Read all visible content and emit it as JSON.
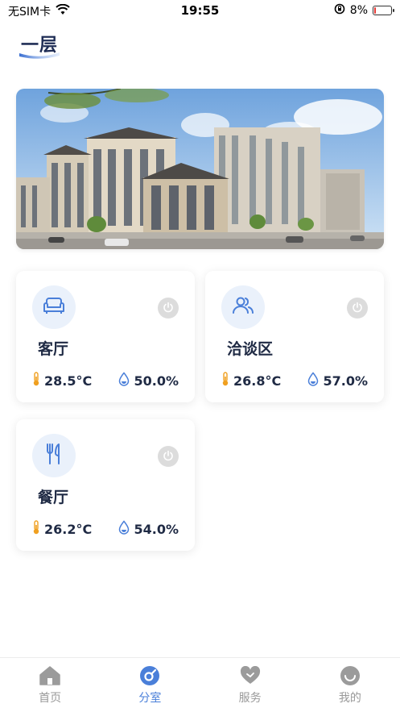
{
  "status_bar": {
    "carrier": "无SIM卡",
    "time": "19:55",
    "battery_percent": "8%",
    "battery_level": 0.08
  },
  "header": {
    "title": "一层"
  },
  "rooms": [
    {
      "name": "客厅",
      "icon": "sofa-icon",
      "temperature": "28.5°C",
      "humidity": "50.0%"
    },
    {
      "name": "洽谈区",
      "icon": "people-icon",
      "temperature": "26.8°C",
      "humidity": "57.0%"
    },
    {
      "name": "餐厅",
      "icon": "fork-knife-icon",
      "temperature": "26.2°C",
      "humidity": "54.0%"
    }
  ],
  "tabs": [
    {
      "label": "首页",
      "icon": "home-icon",
      "active": false
    },
    {
      "label": "分室",
      "icon": "compass-icon",
      "active": true
    },
    {
      "label": "服务",
      "icon": "heart-icon",
      "active": false
    },
    {
      "label": "我的",
      "icon": "smile-icon",
      "active": false
    }
  ],
  "colors": {
    "accent": "#4a7fd9",
    "title": "#1f2d55",
    "thermometer": "#f0a020",
    "droplet": "#4a7fd9",
    "power_off": "#dcdcdc"
  }
}
